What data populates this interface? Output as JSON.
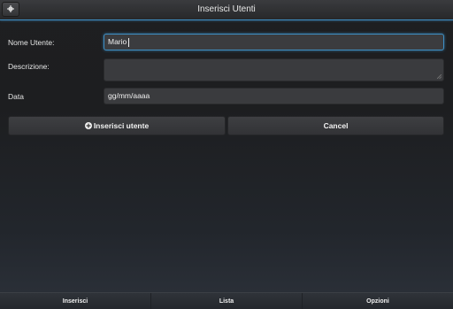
{
  "header": {
    "title": "Inserisci Utenti",
    "gear_icon": "gear-icon"
  },
  "form": {
    "username": {
      "label": "Nome Utente:",
      "value": "Mario"
    },
    "description": {
      "label": "Descrizione:",
      "value": ""
    },
    "date": {
      "label": "Data",
      "value": "gg/mm/aaaa"
    }
  },
  "actions": {
    "insert_label": "Inserisci utente",
    "insert_icon": "plus-circle-icon",
    "cancel_label": "Cancel"
  },
  "navbar": {
    "items": [
      {
        "label": "Inserisci"
      },
      {
        "label": "Lista"
      },
      {
        "label": "Opzioni"
      }
    ]
  },
  "colors": {
    "accent": "#3e8fc4",
    "background": "#1d1e20",
    "field": "#3a3b3e"
  }
}
